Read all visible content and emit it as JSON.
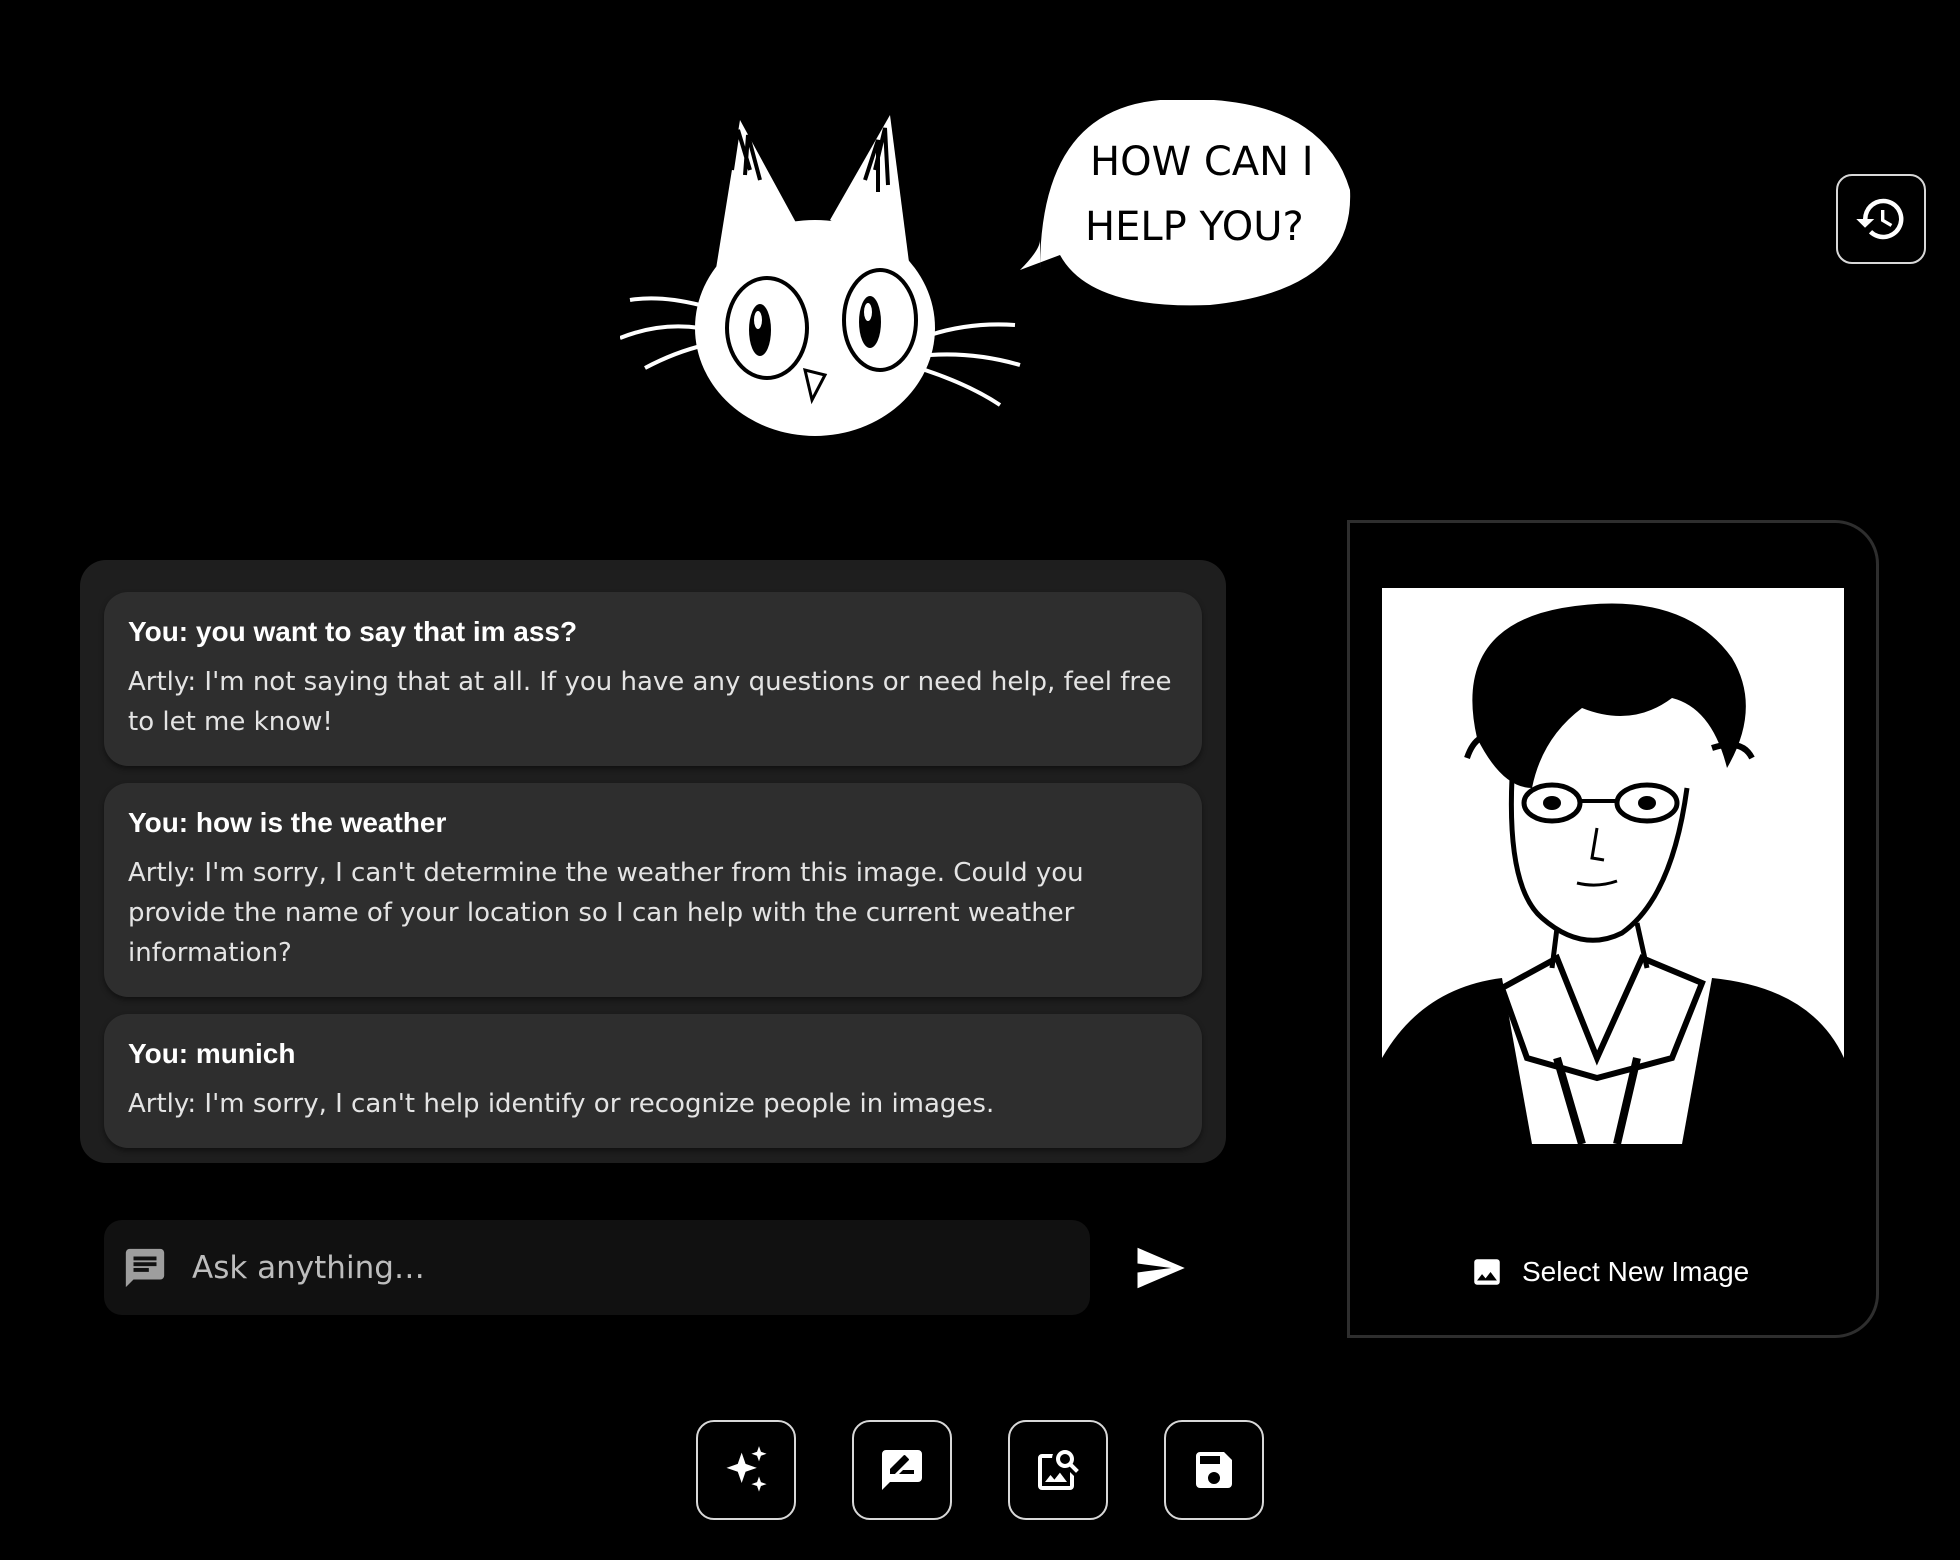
{
  "mascot": {
    "speech_bubble_line1": "HOW CAN I",
    "speech_bubble_line2": "HELP YOU?"
  },
  "header": {
    "history_icon": "history-icon"
  },
  "chat": {
    "messages": [
      {
        "user": "You: you want to say that im ass?",
        "bot": "Artly: I'm not saying that at all. If you have any questions or need help, feel free to let me know!"
      },
      {
        "user": "You: how is the weather",
        "bot": "Artly: I'm sorry, I can't determine the weather from this image. Could you provide the name of your location so I can help with the current weather information?"
      },
      {
        "user": "You: munich",
        "bot": "Artly: I'm sorry, I can't help identify or recognize people in images."
      }
    ]
  },
  "input": {
    "placeholder": "Ask anything…",
    "value": "",
    "icon": "chat-icon",
    "send_icon": "send-icon"
  },
  "image_panel": {
    "select_label": "Select New Image",
    "select_icon": "image-icon"
  },
  "toolbar": {
    "buttons": [
      {
        "icon": "sparkles-icon"
      },
      {
        "icon": "draw-icon"
      },
      {
        "icon": "image-search-icon"
      },
      {
        "icon": "save-icon"
      }
    ]
  },
  "colors": {
    "background": "#000000",
    "panel": "#1e1e1e",
    "message": "#2e2e2e",
    "input": "#111111",
    "text": "#ffffff"
  }
}
